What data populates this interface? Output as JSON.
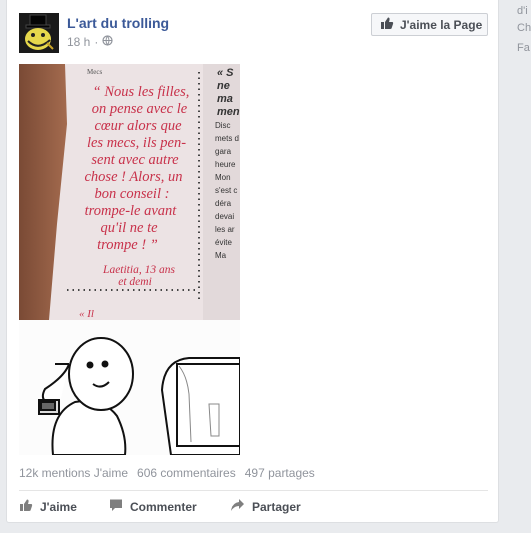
{
  "post": {
    "page_name": "L'art du trolling",
    "time": "18 h",
    "privacy_icon": "globe-icon",
    "like_page_label": "J'aime la Page",
    "photo": {
      "quote_lines": [
        "“ Nous les filles,",
        "on pense avec le",
        "cœur alors que",
        "les mecs, ils pen-",
        "sent avec autre",
        "chose ! Alors, un",
        "bon conseil :",
        "trompe-le avant",
        "qu'il ne te",
        "trompe ! ”"
      ],
      "attribution_line1": "Laetitia, 13 ans",
      "attribution_line2": "et demi",
      "magazine_header": "Mecs",
      "right_column_lines": [
        "« S",
        "ne",
        "ma",
        "men",
        "Disc",
        "mets d",
        "gara",
        "heure",
        "Mon",
        "s'est c",
        "déra",
        "devai",
        "les ar",
        "évite",
        "Ma"
      ],
      "bottom_quote_start": "« Il"
    },
    "stats": {
      "likes": "12k mentions J'aime",
      "comments": "606 commentaires",
      "shares": "497 partages"
    },
    "actions": {
      "like": "J'aime",
      "comment": "Commenter",
      "share": "Partager"
    },
    "colors": {
      "link_blue": "#3b5998",
      "quote_red": "#c8314a"
    }
  },
  "sidebar": {
    "line1": "d'i",
    "line2": "Ch",
    "line3": "Fa"
  }
}
